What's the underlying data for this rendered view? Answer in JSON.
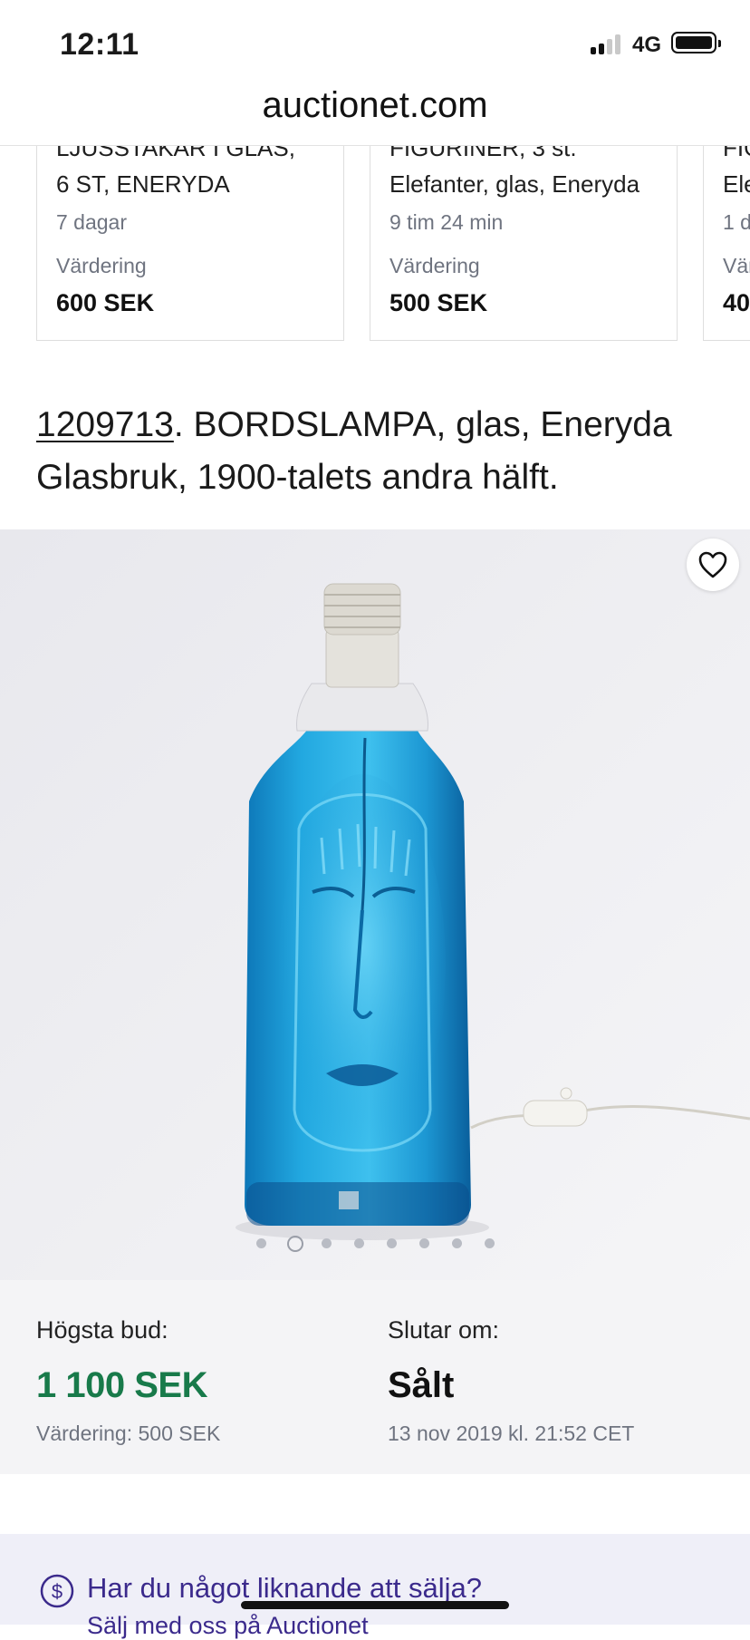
{
  "status_bar": {
    "time": "12:11",
    "network": "4G"
  },
  "browser": {
    "url": "auctionet.com"
  },
  "related_items": [
    {
      "line1": "LJUSSTAKAR I GLAS,",
      "line2": "6 ST, ENERYDA",
      "time_left": "7 dagar",
      "valuation_label": "Värdering",
      "valuation": "600 SEK"
    },
    {
      "line1": "FIGURINER, 3 st.",
      "line2": "Elefanter, glas, Eneryda",
      "time_left": "9 tim 24 min",
      "valuation_label": "Värdering",
      "valuation": "500 SEK"
    },
    {
      "line1": "FIG",
      "line2": "Ele",
      "time_left": "1 d",
      "valuation_label": "Vär",
      "valuation": "40"
    }
  ],
  "lot": {
    "number": "1209713",
    "title_rest": ". BORDSLAMPA, glas, Eneryda Glasbruk, 1900-talets andra hälft."
  },
  "gallery": {
    "image_count": 8,
    "active_index": 1,
    "colors": {
      "glass": "#1e9fd6",
      "background": "#eeeef1"
    }
  },
  "bidding": {
    "highest_bid_label": "Högsta bud:",
    "highest_bid": "1 100 SEK",
    "valuation_text": "Värdering: 500 SEK",
    "ends_label": "Slutar om:",
    "status": "Sålt",
    "end_time": "13 nov 2019 kl. 21:52 CET"
  },
  "sell_banner": {
    "question": "Har du något liknande att sälja?",
    "subtext": "Sälj med oss på Auctionet"
  },
  "colors": {
    "price_green": "#187a4a",
    "accent_purple": "#3b2a8c"
  }
}
